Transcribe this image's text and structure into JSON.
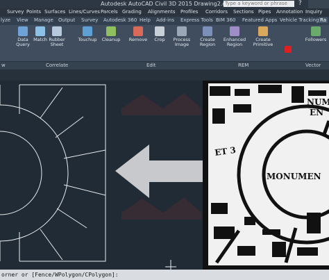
{
  "titlebar": {
    "title": "Autodesk AutoCAD Civil 3D 2015    Drawing2.dwg",
    "search_placeholder": "Type a keyword or phrase",
    "help": "?"
  },
  "menubar": {
    "items": [
      "Survey",
      "Points",
      "Surfaces",
      "Lines/Curves",
      "Parcels",
      "Grading",
      "Alignments",
      "Profiles",
      "Corridors",
      "Sections",
      "Pipes",
      "Annotation",
      "Inquiry"
    ]
  },
  "ribbon_tabs": {
    "items": [
      "lyze",
      "View",
      "Manage",
      "Output",
      "Survey",
      "Autodesk 360",
      "Help",
      "Add-ins",
      "Express Tools",
      "BIM 360",
      "Featured Apps",
      "Vehicle Tracking",
      "Ra"
    ],
    "active_index": 12
  },
  "ribbon": {
    "tools": [
      {
        "label1": "Data",
        "label2": "Query"
      },
      {
        "label1": "Match",
        "label2": ""
      },
      {
        "label1": "Rubber",
        "label2": "Sheet"
      },
      {
        "label1": "Touchup",
        "label2": ""
      },
      {
        "label1": "Cleanup",
        "label2": ""
      },
      {
        "label1": "Remove",
        "label2": ""
      },
      {
        "label1": "Crop",
        "label2": ""
      },
      {
        "label1": "Process",
        "label2": "Image"
      },
      {
        "label1": "Create",
        "label2": "Region"
      },
      {
        "label1": "Enhanced",
        "label2": "Region"
      },
      {
        "label1": "Create",
        "label2": "Primitive"
      },
      {
        "label1": "Followers",
        "label2": ""
      }
    ],
    "panels": [
      "w",
      "Correlate",
      "Edit",
      "REM",
      "Vector"
    ]
  },
  "command_line": {
    "text": "orner or [Fence/WPolygon/CPolygon]:"
  },
  "colors": {
    "canvas": "#212b35",
    "linework": "#e9ecef",
    "arrow": "#c7c9cc",
    "accent_red": "#e02020"
  }
}
